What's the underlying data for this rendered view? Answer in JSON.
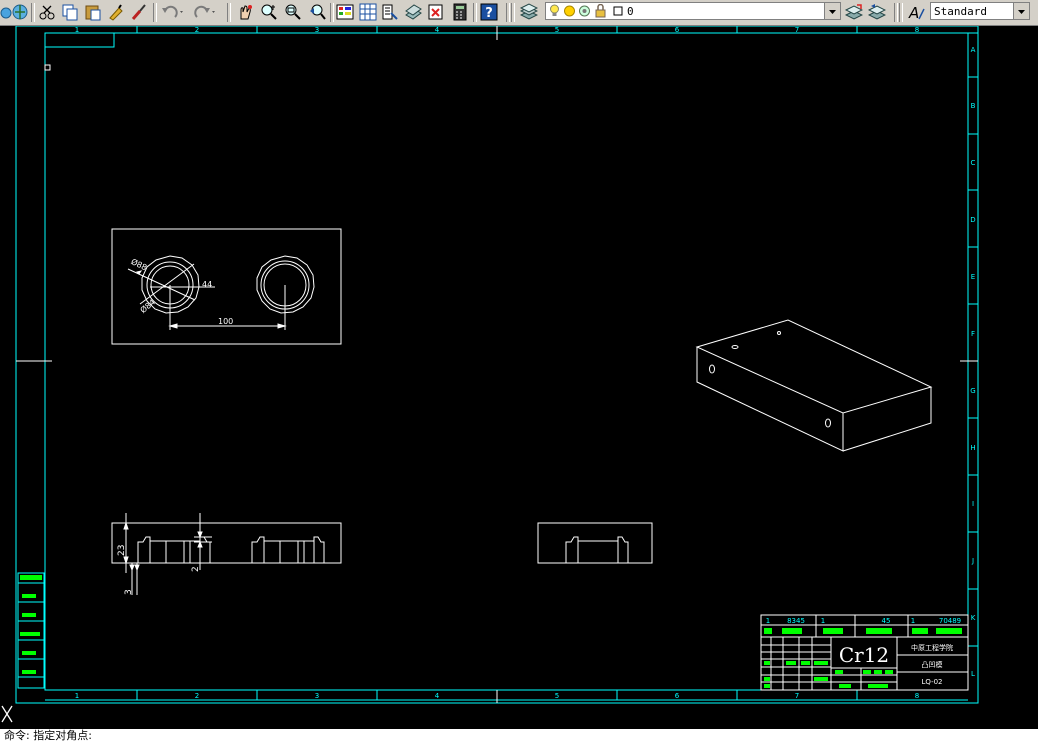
{
  "toolbar": {
    "layer_name": "0",
    "text_style": "Standard",
    "icons": [
      "globe-icon",
      "cut-icon",
      "copy-icon",
      "paste-icon",
      "match-properties-icon",
      "brush-icon",
      "undo-icon",
      "redo-icon",
      "pan-icon",
      "zoom-realtime-icon",
      "zoom-window-icon",
      "zoom-previous-icon",
      "properties-icon",
      "design-center-icon",
      "tool-palettes-icon",
      "sheet-set-icon",
      "markup-icon",
      "quickcalc-icon",
      "help-icon",
      "layer-manager-icon",
      "lightbulb-icon",
      "sun-icon",
      "freeze-icon",
      "lock-icon",
      "layer-color-icon",
      "make-layer-current-icon",
      "layer-previous-icon",
      "text-style-icon"
    ]
  },
  "drawing": {
    "top_ruler": [
      "1",
      "2",
      "3",
      "4",
      "5",
      "6",
      "7",
      "8"
    ],
    "bottom_ruler": [
      "1",
      "2",
      "3",
      "4",
      "5",
      "6",
      "7",
      "8"
    ],
    "right_ruler": [
      "A",
      "B",
      "C",
      "D",
      "E",
      "F",
      "G",
      "H",
      "I",
      "J",
      "K",
      "L"
    ],
    "dimensions": {
      "center_distance": "100",
      "diameter_outer": "Ø88",
      "diameter_inner": "Ø84",
      "radius_small": "44",
      "height": "23",
      "step": "2",
      "base": "3"
    },
    "title_block": {
      "row1": [
        "1",
        "8345",
        "1",
        "45",
        "1",
        "70489"
      ],
      "material": "Cr12",
      "school": "中原工程学院",
      "part_name": "凸凹模",
      "drawing_no": "LQ-02"
    }
  },
  "colors": {
    "canvas_bg": "#000000",
    "frame": "#00ffff",
    "geometry": "#ffffff",
    "annotation": "#00ff00"
  },
  "command_line": "命令: 指定对角点:"
}
